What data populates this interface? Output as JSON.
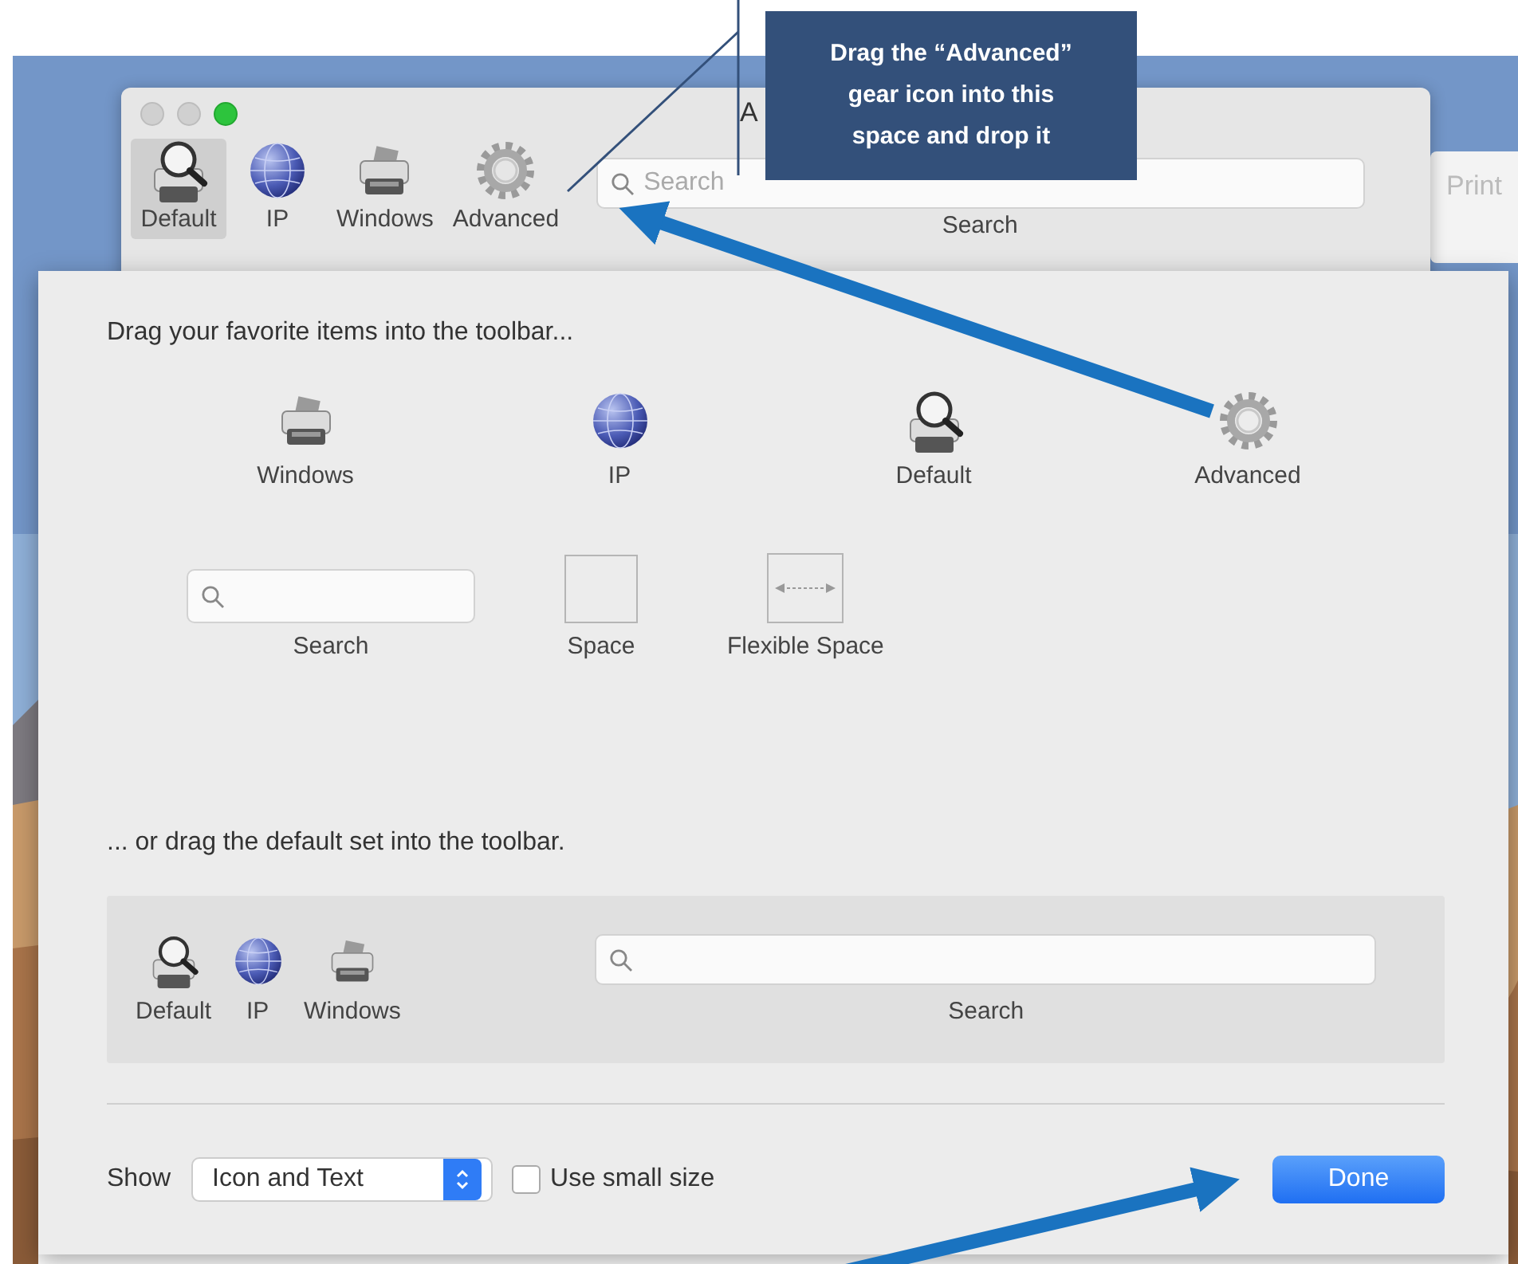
{
  "window": {
    "title": "A",
    "toolbar": [
      {
        "kind": "default",
        "label": "Default",
        "selected": true
      },
      {
        "kind": "globe",
        "label": "IP",
        "selected": false
      },
      {
        "kind": "printer",
        "label": "Windows",
        "selected": false
      },
      {
        "kind": "gear",
        "label": "Advanced",
        "selected": false
      },
      {
        "kind": "search",
        "label": "Search",
        "placeholder": "Search",
        "selected": false
      }
    ]
  },
  "other_window": {
    "text": "Print"
  },
  "sheet": {
    "heading": "Drag your favorite items into the toolbar...",
    "rows": [
      {
        "items": [
          {
            "kind": "printer",
            "label": "Windows"
          },
          {
            "kind": "globe",
            "label": "IP"
          },
          {
            "kind": "default",
            "label": "Default"
          },
          {
            "kind": "gear",
            "label": "Advanced"
          }
        ]
      },
      {
        "items": [
          {
            "kind": "search",
            "label": "Search"
          },
          {
            "kind": "space",
            "label": "Space"
          },
          {
            "kind": "flexible-space",
            "label": "Flexible Space"
          }
        ]
      }
    ],
    "default_set_heading": "... or drag the default set into the toolbar.",
    "default_set": [
      {
        "kind": "default",
        "label": "Default"
      },
      {
        "kind": "globe",
        "label": "IP"
      },
      {
        "kind": "printer",
        "label": "Windows"
      },
      {
        "kind": "search",
        "label": "Search"
      }
    ],
    "show_label": "Show",
    "show_value": "Icon and Text",
    "small_size": {
      "label": "Use small size",
      "checked": false
    },
    "done": "Done"
  },
  "callout": {
    "text": "Drag the “Advanced” gear icon into this space and drop it"
  }
}
